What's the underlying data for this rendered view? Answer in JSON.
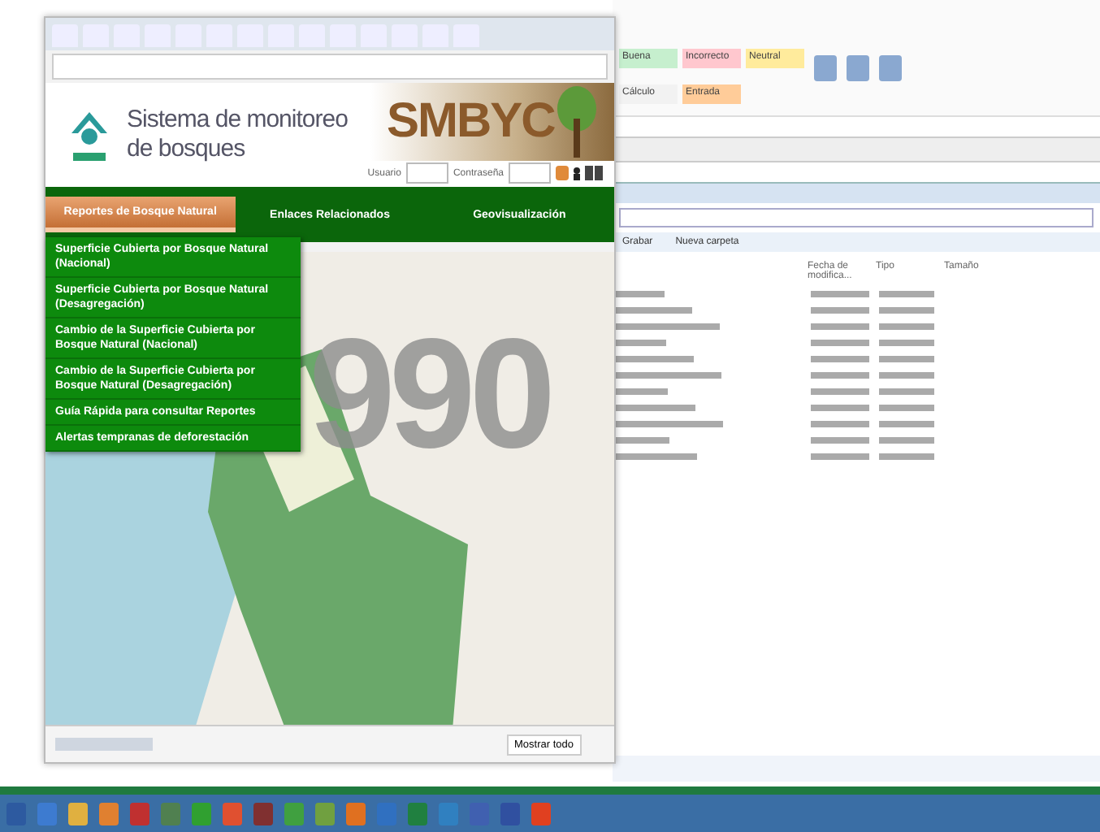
{
  "site": {
    "title_line_1": "Sistema de monitoreo",
    "title_line_2": "de bosques",
    "logo_text": "SMBYC",
    "user_label": "Usuario",
    "password_label": "Contraseña"
  },
  "nav": [
    {
      "label": "Reportes de Bosque Natural",
      "selected": true
    },
    {
      "label": "Enlaces Relacionados",
      "selected": false
    },
    {
      "label": "Geovisualización",
      "selected": false
    }
  ],
  "menu": [
    "Superficie Cubierta por Bosque Natural (Nacional)",
    "Superficie Cubierta por Bosque Natural (Desagregación)",
    "Cambio de la Superficie Cubierta por Bosque Natural (Nacional)",
    "Cambio de la Superficie Cubierta por Bosque Natural (Desagregación)",
    "Guía Rápida para consultar Reportes",
    "Alertas tempranas de deforestación"
  ],
  "map": {
    "year_overlay": "990"
  },
  "download_bar": {
    "show_all": "Mostrar todo"
  },
  "excel": {
    "styles": [
      {
        "label": "Buena",
        "color": "#c6efce"
      },
      {
        "label": "Incorrecto",
        "color": "#ffc7ce"
      },
      {
        "label": "Neutral",
        "color": "#ffeb9c"
      },
      {
        "label": "Cálculo",
        "color": "#f2f2f2"
      },
      {
        "label": "Entrada",
        "color": "#ffcc99"
      }
    ]
  },
  "explorer": {
    "toolbar": [
      "Grabar",
      "Nueva carpeta"
    ],
    "columns": [
      "Fecha de modifica...",
      "Tipo",
      "Tamaño"
    ]
  }
}
